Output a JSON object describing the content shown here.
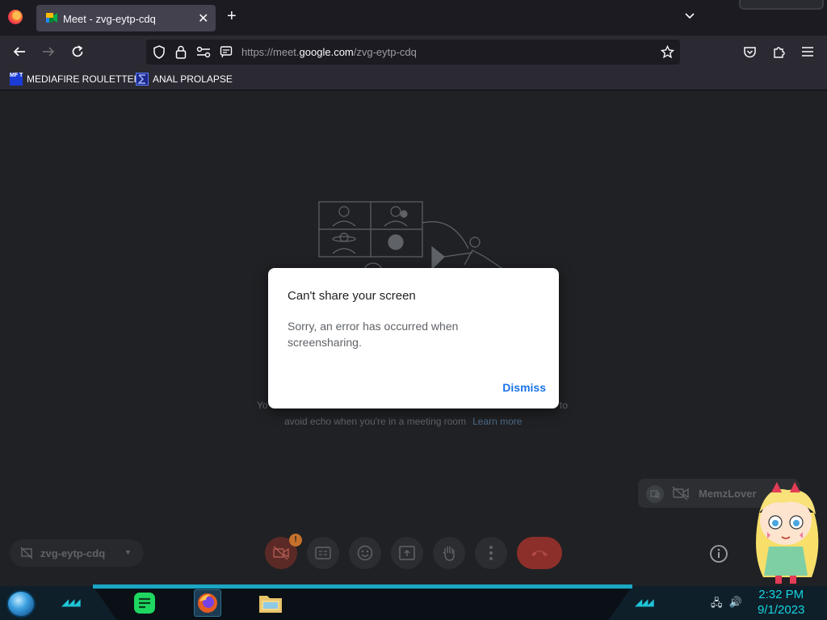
{
  "browser": {
    "tab_title": "Meet - zvg-eytp-cdq",
    "url_prefix": "https://meet.",
    "url_domain": "google.com",
    "url_path": "/zvg-eytp-cdq",
    "bookmarks": [
      {
        "label": "MEDIAFIRE ROULETTER",
        "icon_text": "MF T"
      },
      {
        "label": "ANAL PROLAPSE"
      }
    ]
  },
  "dialog": {
    "title": "Can't share your screen",
    "body": "Sorry, an error has occurred when screensharing.",
    "dismiss_label": "Dismiss"
  },
  "background_text": {
    "line1_start": "Yo",
    "line1_end": "to",
    "line2": "avoid echo when you're in a meeting room",
    "learn_more": "Learn more"
  },
  "self_tile": {
    "name": "MemzLover"
  },
  "meeting": {
    "code": "zvg-eytp-cdq"
  },
  "controls": {
    "camera_badge": "!"
  },
  "taskbar": {
    "time": "2:32 PM",
    "date": "9/1/2023"
  },
  "colors": {
    "accent_blue": "#1a73e8",
    "leave_red": "#8c2f2b",
    "taskbar_cyan": "#16d4e0"
  }
}
